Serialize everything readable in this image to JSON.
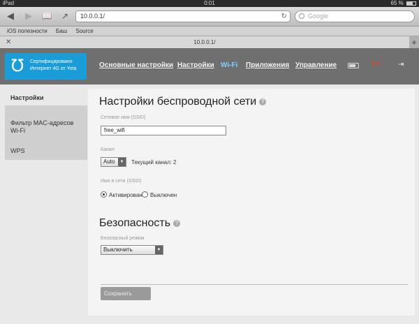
{
  "status": {
    "device": "iPad",
    "time": "0:01",
    "battery": "65 %"
  },
  "browser": {
    "url": "10.0.0.1/",
    "search_placeholder": "Google",
    "bookmarks": [
      "iOS полезности",
      "Баш",
      "Source"
    ],
    "tab_title": "10.0.0.1/"
  },
  "header": {
    "logo_text_1": "Сертифицировано",
    "logo_text_2": "Интернет 4G от Yota",
    "nav": [
      "Основные настройки",
      "Настройки",
      "Wi-Fi",
      "Приложения",
      "Управление"
    ],
    "active_nav": "Wi-Fi"
  },
  "sidebar": {
    "items": [
      "Настройки",
      "Фильтр MAC-адресов",
      "Wi-Fi",
      "WPS"
    ]
  },
  "wifi": {
    "title": "Настройки беспроводной сети",
    "ssid_label": "Сетевое имя (SSID)",
    "ssid_value": "free_wifi",
    "channel_label": "Канал",
    "channel_value": "Auto",
    "current_channel_label": "Текущий канал:",
    "current_channel_value": "2",
    "ssid_broadcast_label": "Имя в сети (SSID)",
    "option_on": "Активирован",
    "option_off": "Выключен",
    "selected": "on"
  },
  "security": {
    "title": "Безопасность",
    "mode_label": "Безопасный режим",
    "mode_value": "Выключить"
  },
  "save_label": "Сохранить"
}
